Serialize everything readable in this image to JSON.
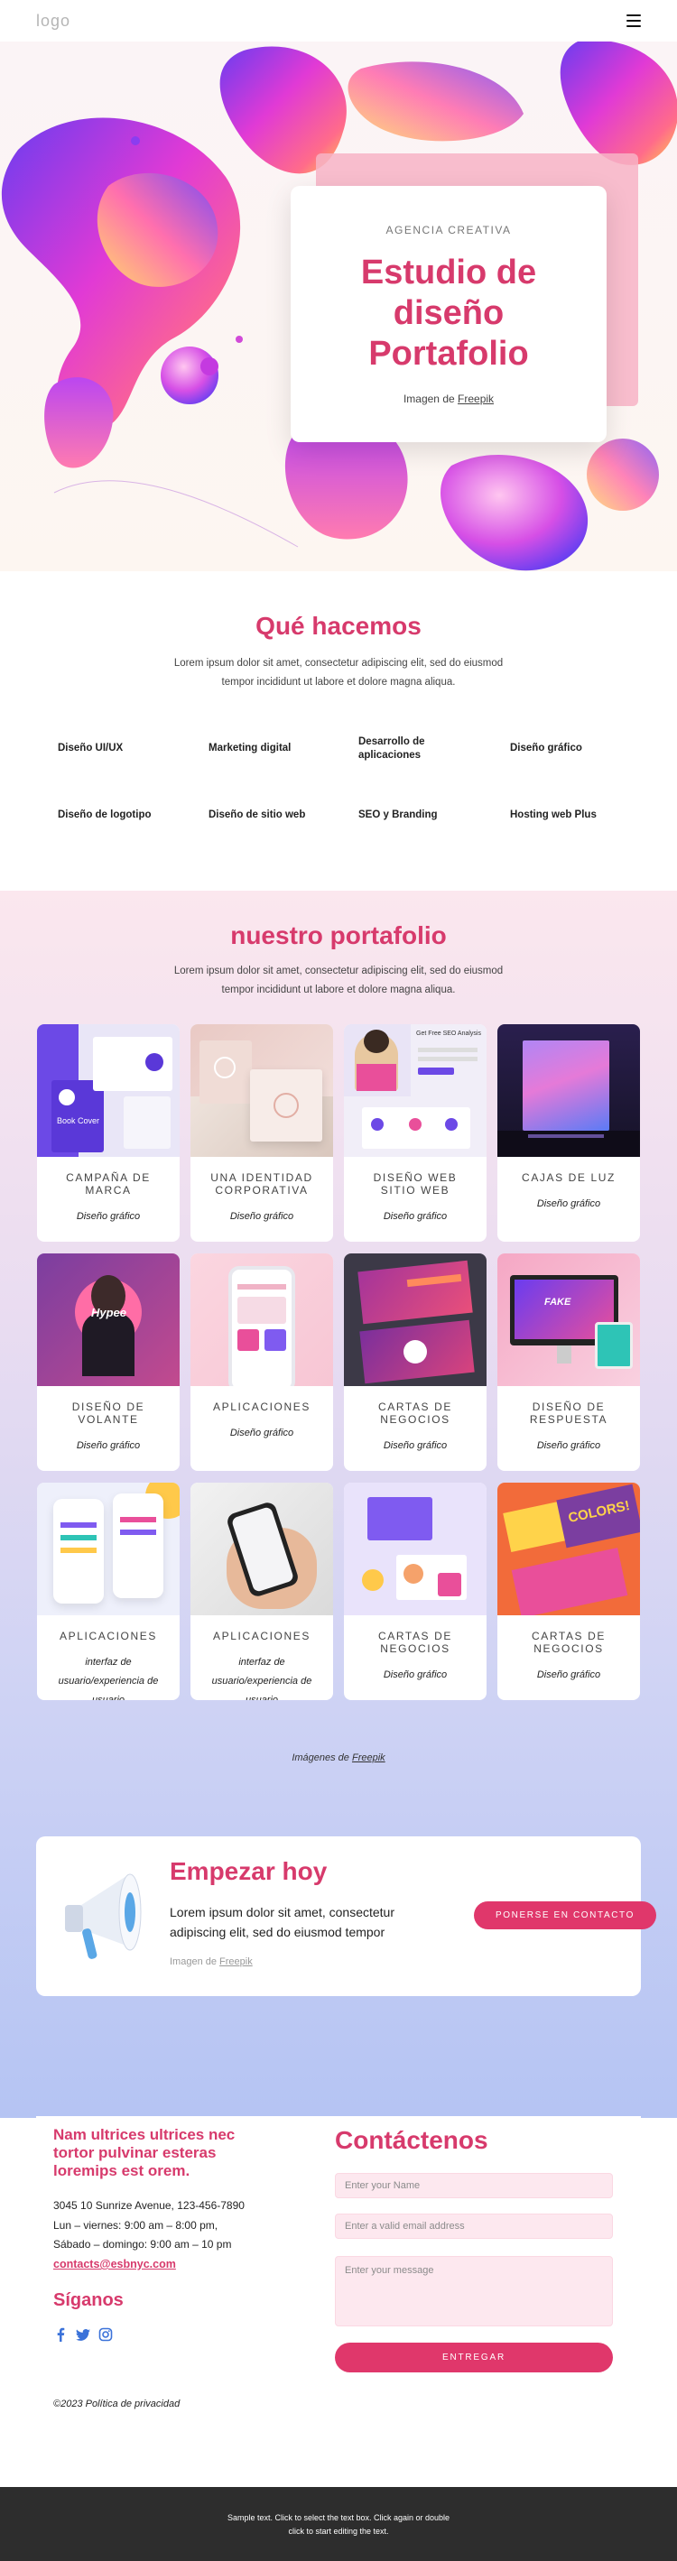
{
  "header": {
    "logo": "logo"
  },
  "hero": {
    "kicker": "AGENCIA CREATIVA",
    "title_lines": [
      "Estudio de",
      "diseño",
      "Portafolio"
    ],
    "credit_prefix": "Imagen de",
    "credit_link": "Freepik"
  },
  "services": {
    "title": "Qué hacemos",
    "desc": "Lorem ipsum dolor sit amet, consectetur adipiscing elit, sed do eiusmod tempor incididunt ut labore et dolore magna aliqua.",
    "items": [
      "Diseño UI/UX",
      "Marketing digital",
      "Desarrollo de aplicaciones",
      "Diseño gráfico",
      "Diseño de logotipo",
      "Diseño de sitio web",
      "SEO y Branding",
      "Hosting web Plus"
    ]
  },
  "portfolio": {
    "title": "nuestro portafolio",
    "desc": "Lorem ipsum dolor sit amet, consectetur adipiscing elit, sed do eiusmod tempor incididunt ut labore et dolore magna aliqua.",
    "items": [
      {
        "name": "CAMPAÑA DE MARCA",
        "category": "Diseño gráfico",
        "image_text": "Book Cover"
      },
      {
        "name": "UNA IDENTIDAD CORPORATIVA",
        "category": "Diseño gráfico"
      },
      {
        "name": "DISEÑO WEB SITIO WEB",
        "category": "Diseño gráfico",
        "image_text": "Get Free SEO Analysis"
      },
      {
        "name": "CAJAS DE LUZ",
        "category": "Diseño gráfico"
      },
      {
        "name": "DISEÑO DE VOLANTE",
        "category": "Diseño gráfico",
        "image_text": "Hypee"
      },
      {
        "name": "APLICACIONES",
        "category": "Diseño gráfico"
      },
      {
        "name": "CARTAS DE NEGOCIOS",
        "category": "Diseño gráfico"
      },
      {
        "name": "DISEÑO DE RESPUESTA",
        "category": "Diseño gráfico",
        "image_text": "FAKE"
      },
      {
        "name": "APLICACIONES",
        "category": "interfaz de usuario/experiencia de usuario"
      },
      {
        "name": "APLICACIONES",
        "category": "interfaz de usuario/experiencia de usuario"
      },
      {
        "name": "CARTAS DE NEGOCIOS",
        "category": "Diseño gráfico"
      },
      {
        "name": "CARTAS DE NEGOCIOS",
        "category": "Diseño gráfico",
        "image_text": "COLORS!"
      }
    ],
    "credit_prefix": "Imágenes de",
    "credit_link": "Freepik"
  },
  "start": {
    "title": "Empezar hoy",
    "text": "Lorem ipsum dolor sit amet, consectetur adipiscing elit, sed do eiusmod tempor",
    "credit_prefix": "Imagen de",
    "credit_link": "Freepik",
    "button": "PONERSE EN CONTACTO"
  },
  "contact": {
    "address_title": "Nam ultrices ultrices nec tortor pulvinar esteras loremips est orem.",
    "address": "3045 10 Sunrize Avenue, 123-456-7890",
    "hours_weekdays": "Lun – viernes: 9:00 am – 8:00 pm,",
    "hours_weekend": "Sábado – domingo: 9:00 am – 10 pm",
    "email": "contacts@esbnyc.com",
    "follow_title": "Síganos",
    "copyright": "©2023 Política de privacidad",
    "title": "Contáctenos",
    "name_placeholder": "Enter your Name",
    "email_placeholder": "Enter a valid email address",
    "message_placeholder": "Enter your message",
    "submit": "ENTREGAR"
  },
  "footer": {
    "line1": "Sample text. Click to select the text box. Click again or double",
    "line2": "click to start editing the text."
  },
  "colors": {
    "accent": "#d73a6c",
    "button": "#e0376b",
    "footer": "#2d2d2d"
  },
  "icons": {
    "menu": "hamburger-icon",
    "megaphone": "megaphone-icon",
    "social": [
      "facebook-icon",
      "twitter-icon",
      "instagram-icon"
    ]
  }
}
